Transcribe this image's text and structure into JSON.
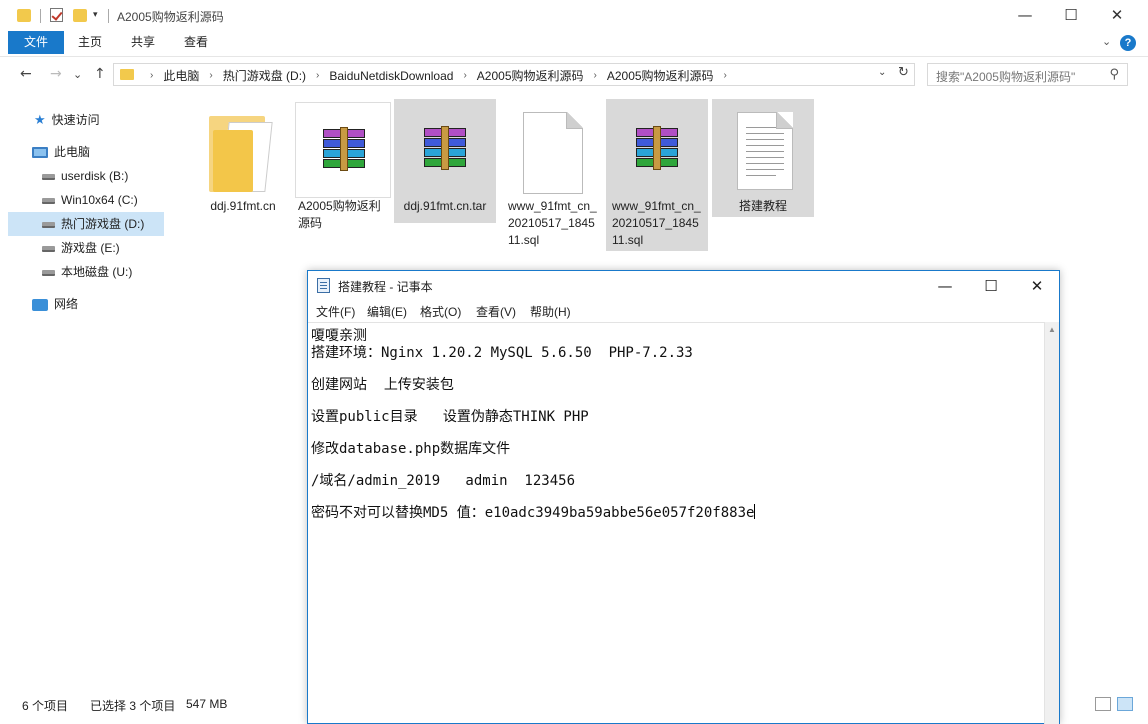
{
  "explorer": {
    "window_title": "A2005购物返利源码",
    "ribbon_tabs": [
      "文件",
      "主页",
      "共享",
      "查看"
    ],
    "nav": {
      "back": "←",
      "forward": "→",
      "dropdown": "⌄",
      "up": "↑"
    },
    "breadcrumb": [
      "此电脑",
      "热门游戏盘 (D:)",
      "BaiduNetdiskDownload",
      "A2005购物返利源码",
      "A2005购物返利源码"
    ],
    "search_placeholder": "搜索\"A2005购物返利源码\"",
    "sidebar": [
      {
        "label": "快速访问",
        "icon": "star-icon"
      },
      {
        "label": "此电脑",
        "icon": "computer-icon"
      },
      {
        "label": "userdisk (B:)",
        "icon": "drive-icon"
      },
      {
        "label": "Win10x64 (C:)",
        "icon": "drive-icon"
      },
      {
        "label": "热门游戏盘 (D:)",
        "icon": "drive-icon",
        "selected": true
      },
      {
        "label": "游戏盘 (E:)",
        "icon": "drive-icon"
      },
      {
        "label": "本地磁盘 (U:)",
        "icon": "drive-icon"
      },
      {
        "label": "网络",
        "icon": "network-icon"
      }
    ],
    "files": [
      {
        "name": "ddj.91fmt.cn",
        "type": "folder",
        "selected": false
      },
      {
        "name": "A2005购物返利源码",
        "type": "rar",
        "selected": false
      },
      {
        "name": "ddj.91fmt.cn.tar",
        "type": "rar",
        "selected": true
      },
      {
        "name": "www_91fmt_cn_20210517_184511.sql",
        "type": "file",
        "selected": false
      },
      {
        "name": "www_91fmt_cn_20210517_184511.sql",
        "type": "rar",
        "selected": true
      },
      {
        "name": "搭建教程",
        "type": "text",
        "selected": true
      }
    ],
    "status": {
      "count": "6 个项目",
      "selection": "已选择 3 个项目",
      "size": "547 MB"
    }
  },
  "notepad": {
    "title": "搭建教程 - 记事本",
    "menu": [
      "文件(F)",
      "编辑(E)",
      "格式(O)",
      "查看(V)",
      "帮助(H)"
    ],
    "lines": [
      "嗄嗄亲测",
      "搭建环境：Nginx 1.20.2 MySQL 5.6.50  PHP-7.2.33",
      "创建网站  上传安装包",
      "设置public目录   设置伪静态THINK PHP",
      "修改database.php数据库文件",
      "/域名/admin_2019   admin  123456",
      "密码不对可以替换MD5 值：e10adc3949ba59abbe56e057f20f883e"
    ]
  },
  "colors": {
    "accent": "#1979ca",
    "selection": "#d9d9d9",
    "nav_selection": "#cce4f7"
  }
}
